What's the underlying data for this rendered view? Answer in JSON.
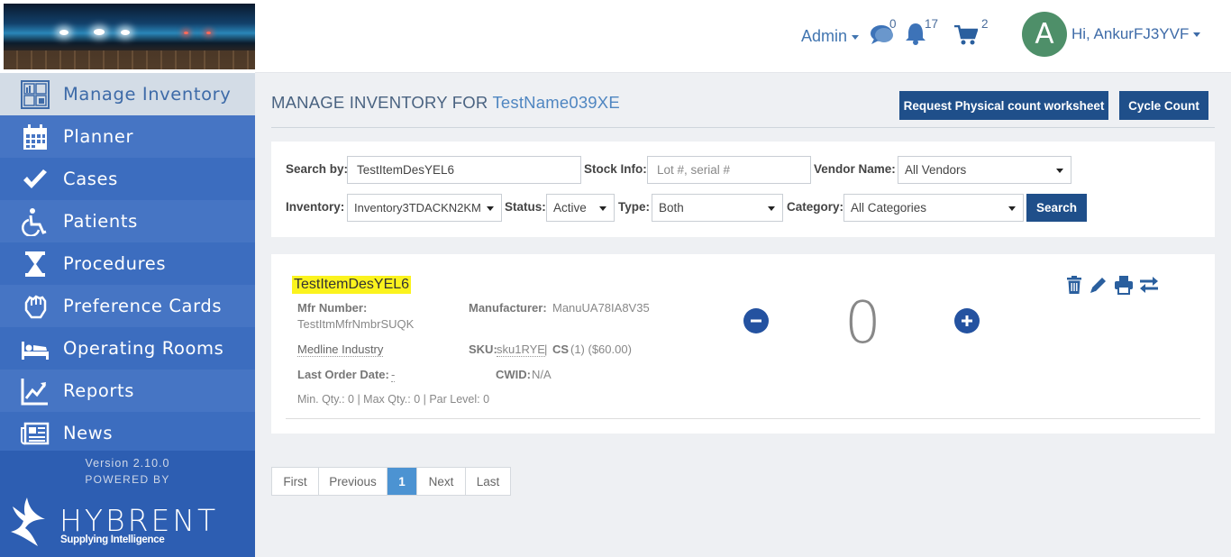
{
  "sidebar": {
    "items": [
      {
        "label": "Manage Inventory",
        "icon": "inventory-grid-icon"
      },
      {
        "label": "Planner",
        "icon": "calendar-icon"
      },
      {
        "label": "Cases",
        "icon": "checkmark-icon"
      },
      {
        "label": "Patients",
        "icon": "wheelchair-icon"
      },
      {
        "label": "Procedures",
        "icon": "hourglass-icon"
      },
      {
        "label": "Preference Cards",
        "icon": "hand-icon"
      },
      {
        "label": "Operating Rooms",
        "icon": "bed-icon"
      },
      {
        "label": "Reports",
        "icon": "chart-icon"
      },
      {
        "label": "News",
        "icon": "newspaper-icon"
      }
    ],
    "version": "Version 2.10.0",
    "powered_by": "POWERED BY",
    "brand": "HYBRENT",
    "brand_tagline": "Supplying Intelligence"
  },
  "header": {
    "admin_label": "Admin",
    "messages_count": "0",
    "notifications_count": "17",
    "cart_count": "2",
    "avatar_letter": "A",
    "greeting": "Hi, AnkurFJ3YVF"
  },
  "page": {
    "title_prefix": "MANAGE INVENTORY FOR",
    "title_name": "TestName039XE",
    "request_button": "Request Physical count worksheet",
    "cycle_button": "Cycle Count"
  },
  "filters": {
    "search_by_label": "Search by:",
    "search_by_value": "TestItemDesYEL6",
    "stock_info_label": "Stock Info:",
    "stock_info_placeholder": "Lot #, serial #",
    "vendor_label": "Vendor Name:",
    "vendor_value": "All Vendors",
    "inventory_label": "Inventory:",
    "inventory_value": "Inventory3TDACKN2KM",
    "status_label": "Status:",
    "status_value": "Active",
    "type_label": "Type:",
    "type_value": "Both",
    "category_label": "Category:",
    "category_value": "All Categories",
    "search_button": "Search"
  },
  "item": {
    "title": "TestItemDesYEL6",
    "mfr_number_label": "Mfr Number:",
    "mfr_number_value": "TestItmMfrNmbrSUQK",
    "manufacturer_label": "Manufacturer:",
    "manufacturer_value": "ManuUA78IA8V35",
    "vendor": "Medline Industry",
    "sku_label": "SKU:",
    "sku_value": "sku1RYE",
    "sku_sep": "|",
    "cs_label": "CS",
    "cs_value": "(1) ($60.00)",
    "last_order_label": "Last Order Date:",
    "last_order_value": "-",
    "cwid_label": "CWID:",
    "cwid_value": "N/A",
    "levels": "Min. Qty.: 0 | Max Qty.: 0 | Par Level: 0",
    "quantity": "0"
  },
  "pagination": {
    "first": "First",
    "previous": "Previous",
    "current": "1",
    "next": "Next",
    "last": "Last"
  },
  "colors": {
    "sidebar": "#3a6bbd",
    "primary_button": "#1f4f8a",
    "highlight": "#fbf31e",
    "avatar": "#4e8f69"
  }
}
